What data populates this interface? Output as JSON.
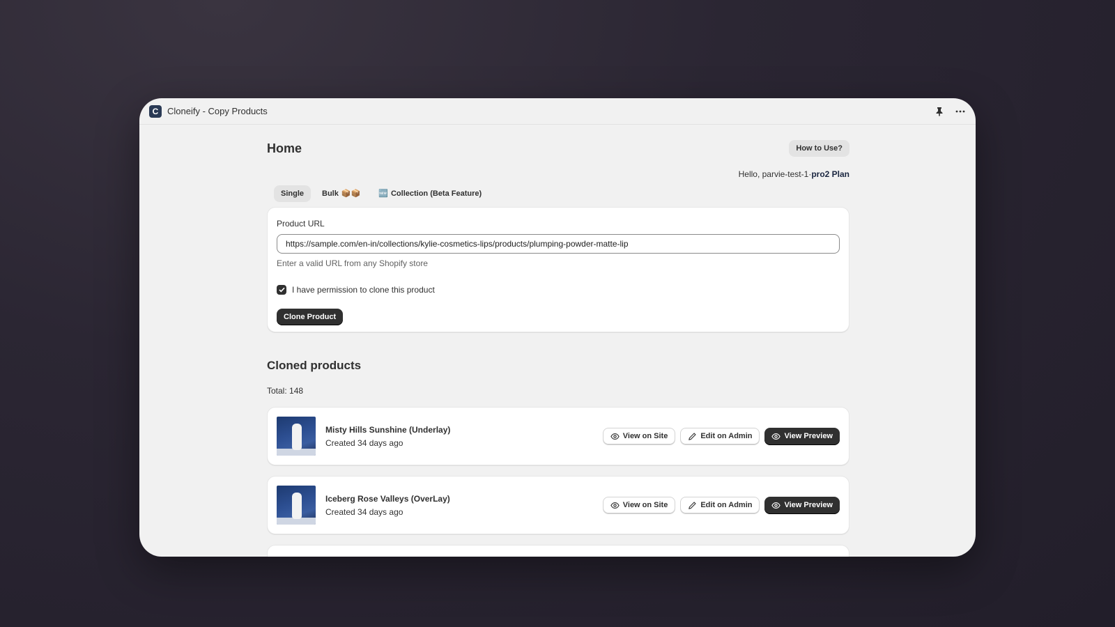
{
  "window": {
    "title": "Cloneify - Copy Products",
    "logo_letter": "C"
  },
  "header": {
    "title": "Home",
    "help_button": "How to Use?"
  },
  "greeting": {
    "prefix": "Hello, parvie-test-1·",
    "plan": "pro2 Plan"
  },
  "tabs": [
    {
      "label": "Single",
      "suffix": "",
      "active": true
    },
    {
      "label": "Bulk",
      "suffix": "📦📦",
      "active": false
    },
    {
      "label": "Collection (Beta Feature)",
      "prefix": "🆕",
      "active": false
    }
  ],
  "form": {
    "url_label": "Product URL",
    "url_value": "https://sample.com/en-in/collections/kylie-cosmetics-lips/products/plumping-powder-matte-lip",
    "help_text": "Enter a valid URL from any Shopify store",
    "permission_label": "I have permission to clone this product",
    "permission_checked": true,
    "submit_label": "Clone Product"
  },
  "cloned": {
    "title": "Cloned products",
    "total": "Total: 148",
    "items": [
      {
        "name": "Misty Hills Sunshine (Underlay)",
        "created": "Created 34 days ago",
        "view_site": "View on Site",
        "edit_admin": "Edit on Admin",
        "view_preview": "View Preview"
      },
      {
        "name": "Iceberg Rose Valleys (OverLay)",
        "created": "Created 34 days ago",
        "view_site": "View on Site",
        "edit_admin": "Edit on Admin",
        "view_preview": "View Preview"
      }
    ]
  },
  "colors": {
    "primary_button": "#303030",
    "window_bg": "#f1f1f1",
    "page_bg": "#262230"
  }
}
